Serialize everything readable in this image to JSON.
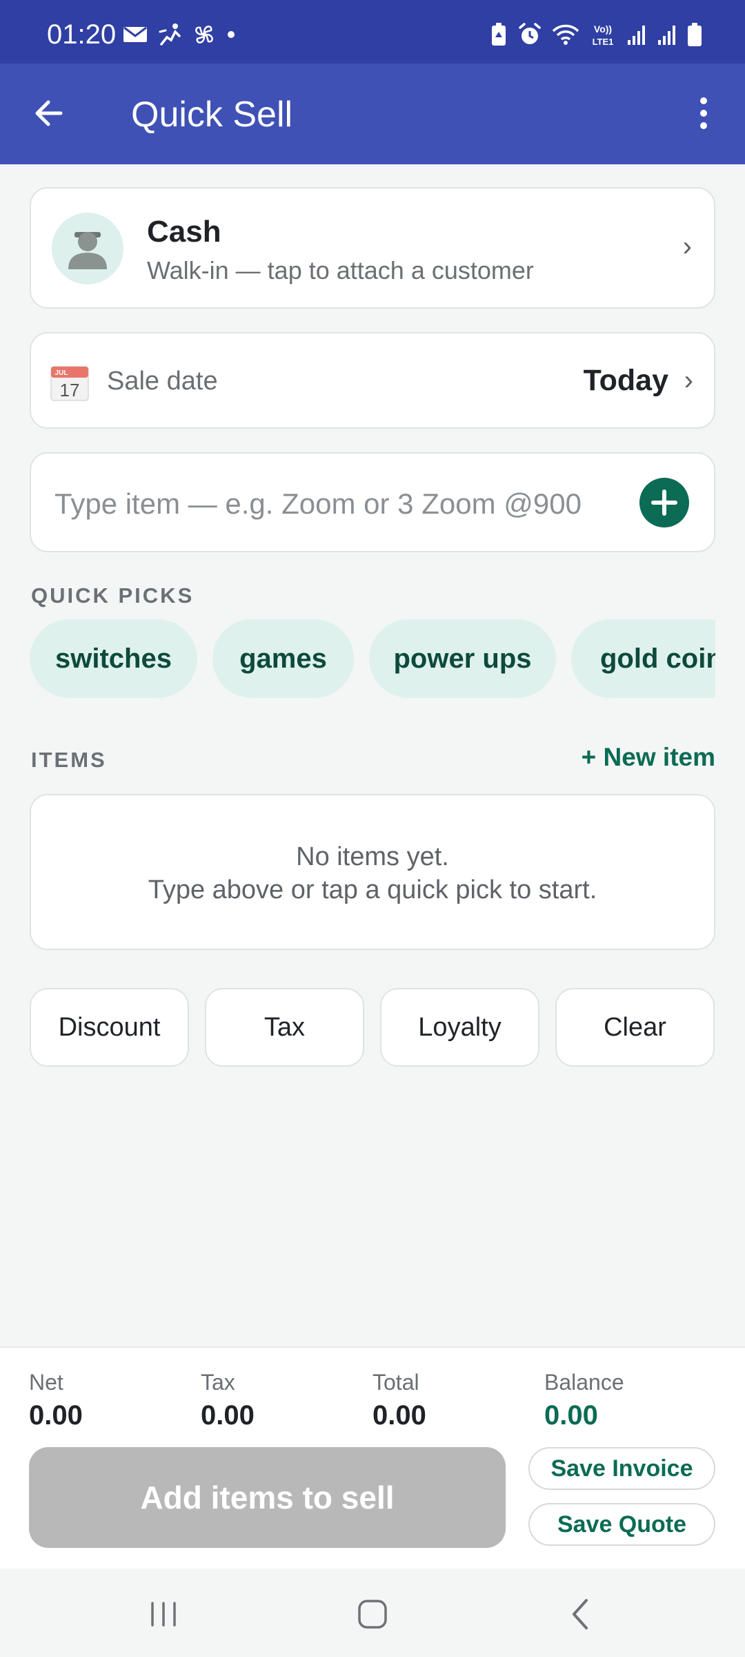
{
  "status_bar": {
    "time": "01:20",
    "left_icons": [
      "mail-icon",
      "activity-icon",
      "pinwheel-icon",
      "dot-icon"
    ],
    "right_icons": [
      "battery-saver-icon",
      "alarm-icon",
      "wifi-icon",
      "volte-icon",
      "signal-icon",
      "signal-icon",
      "battery-icon"
    ],
    "volte_label": "Vo)) LTE1"
  },
  "app_bar": {
    "title": "Quick Sell",
    "back_icon": "arrow-left-icon",
    "menu_icon": "more-vert-icon"
  },
  "customer": {
    "name": "Cash",
    "subtitle": "Walk-in — tap to attach a customer",
    "avatar_icon": "person-icon",
    "chevron": "›"
  },
  "sale_date": {
    "calendar_month": "JUL",
    "calendar_day": "17",
    "label": "Sale date",
    "value": "Today",
    "chevron": "›"
  },
  "item_input": {
    "placeholder": "Type item — e.g. Zoom or 3 Zoom @900",
    "value": "",
    "add_icon": "plus-circle-icon"
  },
  "quick_picks": {
    "label": "QUICK PICKS",
    "chips": [
      "switches",
      "games",
      "power ups",
      "gold coin"
    ]
  },
  "items": {
    "label": "ITEMS",
    "new_item_label": "+ New item",
    "empty_line1": "No items yet.",
    "empty_line2": "Type above or tap a quick pick to start."
  },
  "actions": [
    "Discount",
    "Tax",
    "Loyalty",
    "Clear"
  ],
  "summary": {
    "net_label": "Net",
    "net_value": "0.00",
    "tax_label": "Tax",
    "tax_value": "0.00",
    "total_label": "Total",
    "total_value": "0.00",
    "balance_label": "Balance",
    "balance_value": "0.00"
  },
  "footer_buttons": {
    "primary": "Add items to sell",
    "save_invoice": "Save Invoice",
    "save_quote": "Save Quote"
  },
  "colors": {
    "status_bar": "#2f3fa3",
    "app_bar": "#3f51b5",
    "accent_green": "#0b6b54",
    "chip_bg": "#dff1ed",
    "disabled_button": "#b8b8b8",
    "background": "#f4f6f5"
  }
}
